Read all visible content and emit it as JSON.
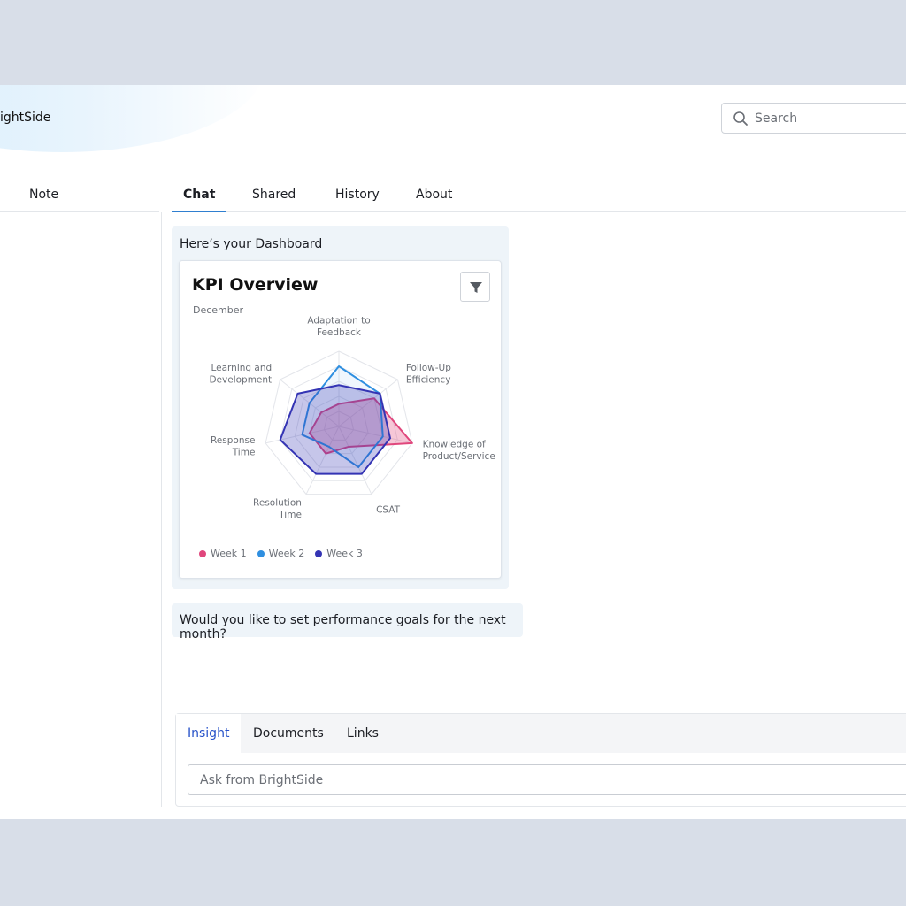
{
  "app": {
    "brand": "ightSide"
  },
  "search": {
    "placeholder": "Search",
    "icon": "search-icon"
  },
  "left_panel": {
    "tab_label": "Note"
  },
  "tabs": [
    {
      "label": "Chat",
      "active": true
    },
    {
      "label": "Shared",
      "active": false
    },
    {
      "label": "History",
      "active": false
    },
    {
      "label": "About",
      "active": false
    }
  ],
  "messages": {
    "intro": "Here’s your Dashboard",
    "followup": "Would you like to set performance goals for the next month?"
  },
  "card": {
    "title": "KPI Overview",
    "subtitle": "December",
    "filter_icon": "filter-icon"
  },
  "chart_data": {
    "type": "radar",
    "subtitle": "December",
    "axes": [
      "Adaptation to Feedback",
      "Follow-Up Efficiency",
      "Knowledge of Product/Service",
      "CSAT",
      "Resolution Time",
      "Response Time",
      "Learning and Development"
    ],
    "axis_label_lines": [
      [
        "Adaptation to",
        "Feedback"
      ],
      [
        "Follow-Up",
        "Efficiency"
      ],
      [
        "Knowledge of",
        "Product/Service"
      ],
      [
        "CSAT"
      ],
      [
        "Resolution",
        "Time"
      ],
      [
        "Response",
        "Time"
      ],
      [
        "Learning and",
        "Development"
      ]
    ],
    "rlim": [
      0,
      100
    ],
    "grid_levels": 5,
    "legend_position": "bottom-left",
    "series": [
      {
        "name": "Week 1",
        "color": "#e0467c",
        "values": [
          30,
          60,
          100,
          30,
          40,
          40,
          30
        ]
      },
      {
        "name": "Week 2",
        "color": "#2f8fe0",
        "values": [
          80,
          70,
          60,
          60,
          30,
          50,
          50
        ]
      },
      {
        "name": "Week 3",
        "color": "#3434b4",
        "values": [
          55,
          70,
          70,
          70,
          70,
          80,
          70
        ]
      }
    ]
  },
  "composer": {
    "tabs": [
      "Insight",
      "Documents",
      "Links"
    ],
    "active_tab": "Insight",
    "placeholder": "Ask from BrightSide"
  }
}
